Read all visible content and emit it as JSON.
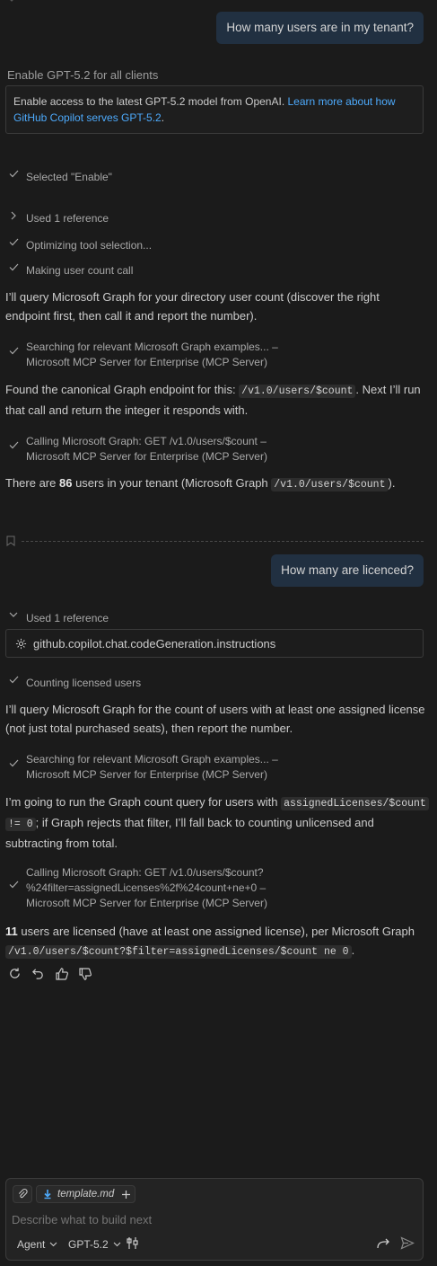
{
  "conversation": {
    "q1": "How many users are in my tenant?",
    "banner": {
      "title": "Enable GPT-5.2 for all clients",
      "text": "Enable access to the latest GPT-5.2 model from OpenAI. ",
      "link": "Learn more about how GitHub Copilot serves GPT-5.2",
      "suffix": "."
    },
    "steps1": {
      "selected": "Selected \"Enable\"",
      "used_ref": "Used 1 reference",
      "optimizing": "Optimizing tool selection...",
      "making_call": "Making user count call"
    },
    "p1": "I’ll query Microsoft Graph for your directory user count (discover the right endpoint first, then call it and report the number).",
    "search1": {
      "line1": "Searching for relevant Microsoft Graph examples... –",
      "line2": "Microsoft MCP Server for Enterprise (MCP Server)"
    },
    "p2": {
      "pre": "Found the canonical Graph endpoint for this: ",
      "code": "/v1.0/users/$count",
      "post": ". Next I’ll run that call and return the integer it responds with."
    },
    "call1": {
      "line1": "Calling Microsoft Graph: GET /v1.0/users/$count –",
      "line2": "Microsoft MCP Server for Enterprise (MCP Server)"
    },
    "answer1": {
      "pre": "There are ",
      "count": "86",
      "mid": " users in your tenant (Microsoft Graph ",
      "code": "/v1.0/users/$count",
      "post": ")."
    },
    "q2": "How many are licenced?",
    "used_ref2": "Used 1 reference",
    "ref_file": "github.copilot.chat.codeGeneration.instructions",
    "counting": "Counting licensed users",
    "p3": "I’ll query Microsoft Graph for the count of users with at least one assigned license (not just total purchased seats), then report the number.",
    "search2": {
      "line1": "Searching for relevant Microsoft Graph examples... –",
      "line2": "Microsoft MCP Server for Enterprise (MCP Server)"
    },
    "p4": {
      "pre": "I’m going to run the Graph count query for users with ",
      "code1": "assignedLicenses/$count",
      "code2": "!= 0",
      "post": "; if Graph rejects that filter, I’ll fall back to counting unlicensed and subtracting from total."
    },
    "call2": {
      "line1": "Calling Microsoft Graph: GET /v1.0/users/$count?",
      "line2": "%24filter=assignedLicenses%2f%24count+ne+0 –",
      "line3": "Microsoft MCP Server for Enterprise (MCP Server)"
    },
    "answer2": {
      "count": "11",
      "text": " users are licensed (have at least one assigned license), per Microsoft Graph",
      "code": "/v1.0/users/$count?$filter=assignedLicenses/$count ne 0",
      "post": "."
    }
  },
  "input": {
    "attachment_file": "template.md",
    "placeholder": "Describe what to build next",
    "mode": "Agent",
    "model": "GPT-5.2"
  },
  "colors": {
    "background": "#1b1b1b",
    "user_bubble": "#213041",
    "link": "#4daafc"
  },
  "icons": [
    "check-icon",
    "chevron-right-icon",
    "chevron-down-icon",
    "gear-icon",
    "bookmark-icon",
    "retry-icon",
    "undo-icon",
    "thumbs-up-icon",
    "thumbs-down-icon",
    "paperclip-icon",
    "markdown-file-icon",
    "plus-icon",
    "tools-icon",
    "forward-icon",
    "send-icon"
  ]
}
